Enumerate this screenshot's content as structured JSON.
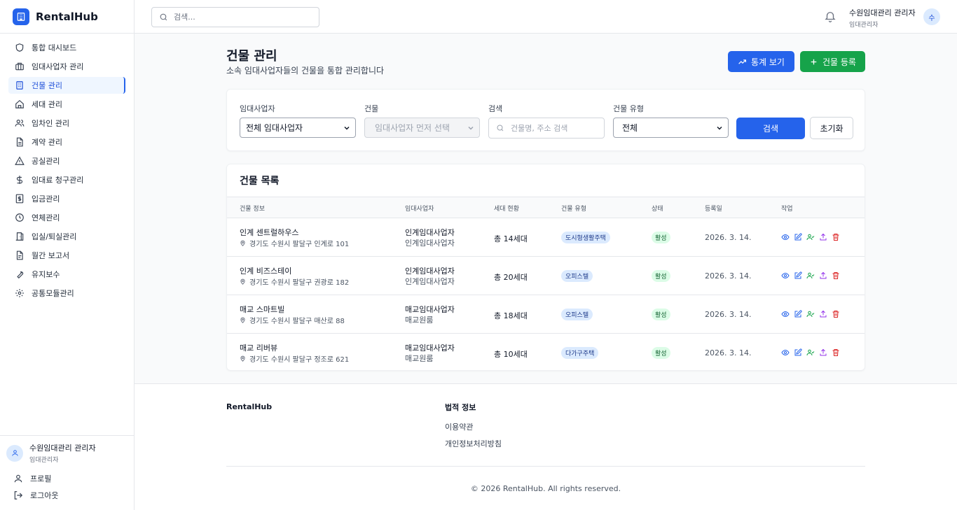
{
  "brand": {
    "name": "RentalHub"
  },
  "sidebar": {
    "items": [
      {
        "label": "통합 대시보드",
        "icon": "shield-icon",
        "active": false
      },
      {
        "label": "임대사업자 관리",
        "icon": "briefcase-icon",
        "active": false
      },
      {
        "label": "건물 관리",
        "icon": "building-icon",
        "active": true
      },
      {
        "label": "세대 관리",
        "icon": "home-icon",
        "active": false
      },
      {
        "label": "임차인 관리",
        "icon": "users-icon",
        "active": false
      },
      {
        "label": "계약 관리",
        "icon": "document-icon",
        "active": false
      },
      {
        "label": "공실관리",
        "icon": "warning-icon",
        "active": false
      },
      {
        "label": "임대료 청구관리",
        "icon": "dollar-icon",
        "active": false
      },
      {
        "label": "입금관리",
        "icon": "receipt-icon",
        "active": false
      },
      {
        "label": "연체관리",
        "icon": "clock-icon",
        "active": false
      },
      {
        "label": "입실/퇴실관리",
        "icon": "door-icon",
        "active": false
      },
      {
        "label": "월간 보고서",
        "icon": "report-icon",
        "active": false
      },
      {
        "label": "유지보수",
        "icon": "wrench-icon",
        "active": false
      },
      {
        "label": "공통모듈관리",
        "icon": "gear-icon",
        "active": false
      }
    ],
    "user": {
      "name": "수원임대관리 관리자",
      "role": "임대관리자"
    },
    "profile_label": "프로필",
    "logout_label": "로그아웃"
  },
  "topbar": {
    "search_placeholder": "검색...",
    "user_name": "수원임대관리 관리자",
    "user_role": "임대관리자",
    "avatar_initial": "수"
  },
  "page": {
    "title": "건물 관리",
    "subtitle": "소속 임대사업자들의 건물을 통합 관리합니다",
    "stats_button": "통계 보기",
    "add_button": "건물 등록"
  },
  "filters": {
    "lessor_label": "임대사업자",
    "lessor_value": "전체 임대사업자",
    "building_label": "건물",
    "building_value": "임대사업자 먼저 선택",
    "search_label": "검색",
    "search_placeholder": "건물명, 주소 검색",
    "type_label": "건물 유형",
    "type_value": "전체",
    "search_button": "검색",
    "reset_button": "초기화"
  },
  "table": {
    "title": "건물 목록",
    "headers": [
      "건물 정보",
      "임대사업자",
      "세대 현황",
      "건물 유형",
      "상태",
      "등록일",
      "작업"
    ],
    "rows": [
      {
        "name": "인계 센트럴하우스",
        "address": "경기도 수원시 팔달구 인계로 101",
        "lessor": "인계임대사업자",
        "lessor_sub": "인계임대사업자",
        "units": "총 14세대",
        "type": "도시형생활주택",
        "status": "활성",
        "date": "2026. 3. 14."
      },
      {
        "name": "인계 비즈스테이",
        "address": "경기도 수원시 팔달구 권광로 182",
        "lessor": "인계임대사업자",
        "lessor_sub": "인계임대사업자",
        "units": "총 20세대",
        "type": "오피스텔",
        "status": "활성",
        "date": "2026. 3. 14."
      },
      {
        "name": "매교 스마트빌",
        "address": "경기도 수원시 팔달구 매산로 88",
        "lessor": "매교임대사업자",
        "lessor_sub": "매교원룸",
        "units": "총 18세대",
        "type": "오피스텔",
        "status": "활성",
        "date": "2026. 3. 14."
      },
      {
        "name": "매교 리버뷰",
        "address": "경기도 수원시 팔달구 정조로 621",
        "lessor": "매교임대사업자",
        "lessor_sub": "매교원룸",
        "units": "총 10세대",
        "type": "다가구주택",
        "status": "활성",
        "date": "2026. 3. 14."
      }
    ]
  },
  "footer": {
    "brand": "RentalHub",
    "legal_title": "법적 정보",
    "terms": "이용약관",
    "privacy": "개인정보처리방침",
    "copyright": "© 2026 RentalHub. All rights reserved."
  },
  "colors": {
    "primary": "#2563eb",
    "success": "#16a34a",
    "danger": "#dc2626",
    "purple": "#9333ea"
  }
}
